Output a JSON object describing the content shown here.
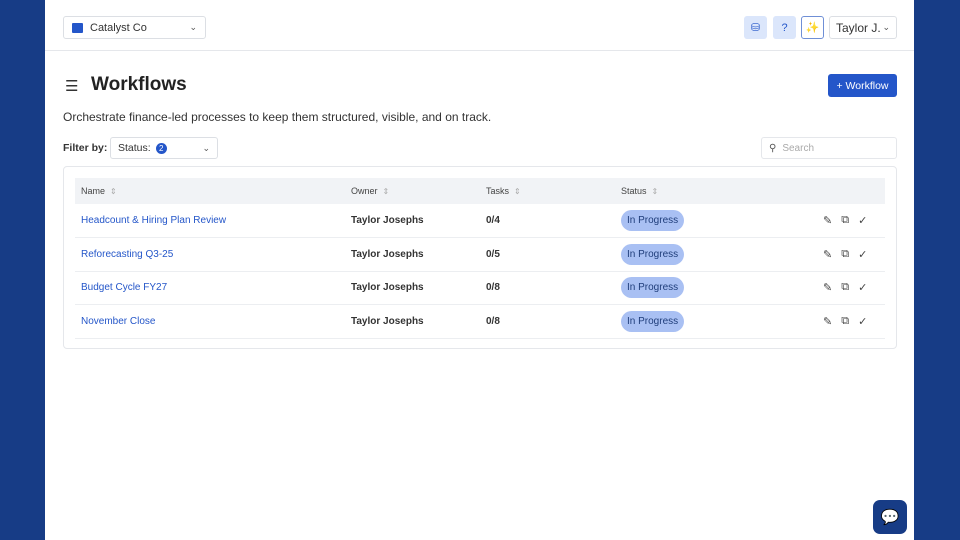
{
  "org": {
    "name": "Catalyst Co"
  },
  "header": {
    "user": "Taylor J.",
    "icons": [
      "database-sync-icon",
      "help-icon",
      "sparkles-icon"
    ]
  },
  "page": {
    "title": "Workflows",
    "description": "Orchestrate finance-led processes to keep them structured, visible, and on track.",
    "add_button": "+ Workflow"
  },
  "filter": {
    "label": "Filter by:",
    "status_label": "Status:",
    "status_count": "2",
    "search_placeholder": "Search"
  },
  "table": {
    "columns": [
      "Name",
      "Owner",
      "Tasks",
      "Status"
    ],
    "rows": [
      {
        "name": "Headcount & Hiring Plan Review",
        "owner": "Taylor Josephs",
        "tasks": "0/4",
        "status": "In Progress"
      },
      {
        "name": "Reforecasting Q3-25",
        "owner": "Taylor Josephs",
        "tasks": "0/5",
        "status": "In Progress"
      },
      {
        "name": "Budget Cycle FY27",
        "owner": "Taylor Josephs",
        "tasks": "0/8",
        "status": "In Progress"
      },
      {
        "name": "November Close",
        "owner": "Taylor Josephs",
        "tasks": "0/8",
        "status": "In Progress"
      }
    ]
  },
  "colors": {
    "accent": "#2456c9",
    "background": "#173c86",
    "status_badge": "#a9c0f3"
  }
}
